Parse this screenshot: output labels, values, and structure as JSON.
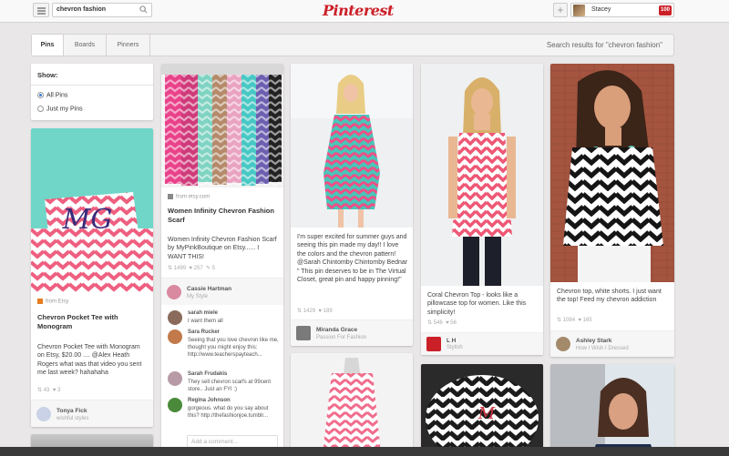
{
  "header": {
    "search_value": "chevron fashion",
    "logo": "Pinterest",
    "user_name": "Stacey",
    "notifications": "100",
    "add_symbol": "+"
  },
  "tabs": [
    {
      "label": "Pins",
      "active": true
    },
    {
      "label": "Boards",
      "active": false
    },
    {
      "label": "Pinners",
      "active": false
    }
  ],
  "results_text": "Search results for \"chevron fashion\"",
  "show_panel": {
    "title": "Show:",
    "options": [
      {
        "label": "All Pins",
        "selected": true
      },
      {
        "label": "Just my Pins",
        "selected": false
      }
    ]
  },
  "pins": {
    "p1": {
      "source": "from Etsy",
      "title": "Chevron Pocket Tee with Monogram",
      "description": "Chevron Pocket Tee with Monogram on Etsy, $20.00 .... @Alex Heath Rogers what was that video you sent me last week? hahahaha",
      "repins": "43",
      "likes": "3",
      "user": "Tonya Fick",
      "board": "wishful styles"
    },
    "p2": {
      "source": "from etsy.com",
      "title": "Women Infinity Chevron Fashion Scarf",
      "description": "Women Infinity Chevron Fashion Scarf by MyPinkBoutique on Etsy...... I WANT THIS!",
      "repins": "1499",
      "likes": "257",
      "comments_count": "5",
      "user": "Cassie Hartman",
      "board": "My Style",
      "comments": [
        {
          "user": "sarah miele",
          "text": "I want them all"
        },
        {
          "user": "Sara Rucker",
          "text": "Seeing that you love chevron like me, thought you might enjoy this: http://www.teacherspayteach..."
        },
        {
          "user": "Sarah Frudakis",
          "text": "They sell chevron scarfs at 99cent store.. Just an FYI :)"
        },
        {
          "user": "Regina Johnson",
          "text": "gorgeous. what do you say about this? http://thefashionjoe.tumblr..."
        }
      ],
      "add_comment_placeholder": "Add a comment..."
    },
    "p3": {
      "description": "I'm super excited for summer guys and seeing this pin made my day!! I love the colors and the chevron pattern! @Sarah Chintomby Chintomby Bednar \" This pin deserves to be in The Virtual Closet, great pin and happy pinning!\"",
      "repins": "1429",
      "likes": "189",
      "user": "Miranda Grace",
      "board": "Passion For Fashion"
    },
    "p4": {
      "description": "Coral Chevron Top - looks like a pillowcase top for women. Like this simplicity!",
      "repins": "546",
      "likes": "56",
      "user": "L H",
      "board": "Stylish"
    },
    "p5": {
      "description": "Chevron top, white shorts. I just want the top! Feed my chevron addiction",
      "repins": "1084",
      "likes": "165",
      "user": "Ashley Stark",
      "board": "How I Wish I Dressed"
    }
  },
  "colors": {
    "brand": "#cb2027",
    "background": "#e9e7e7",
    "radio_selected": "#3b7fd2"
  }
}
